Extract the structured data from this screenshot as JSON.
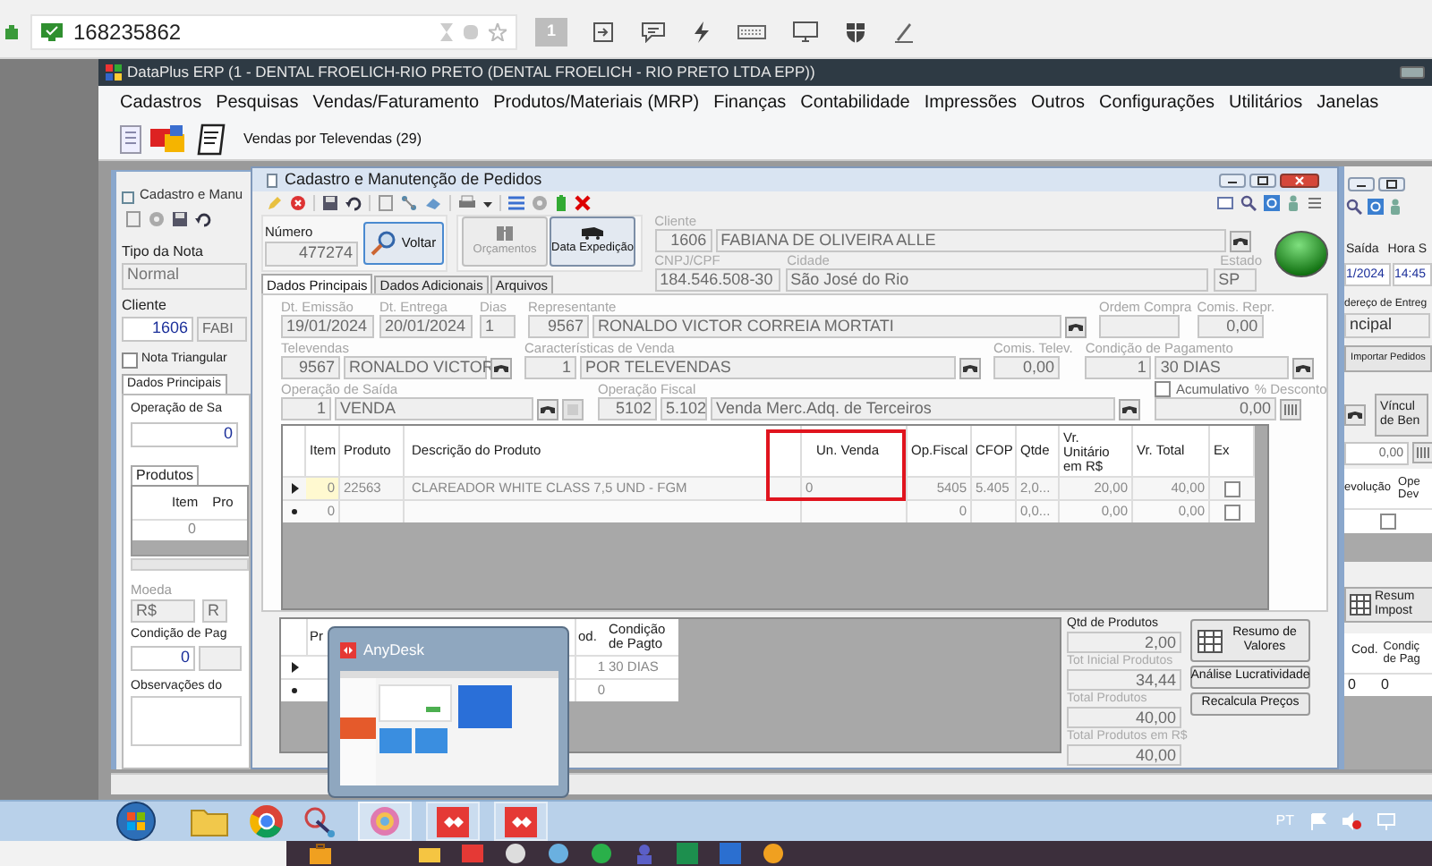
{
  "remote_toolbar": {
    "address": "168235862",
    "display_button": "1"
  },
  "app_window": {
    "title": "DataPlus ERP (1 - DENTAL FROELICH-RIO PRETO  (DENTAL FROELICH - RIO PRETO LTDA EPP))",
    "menu": [
      "Cadastros",
      "Pesquisas",
      "Vendas/Faturamento",
      "Produtos/Materiais (MRP)",
      "Finanças",
      "Contabilidade",
      "Impressões",
      "Outros",
      "Configurações",
      "Utilitários",
      "Janelas"
    ],
    "toolbar_caption": "Vendas por Televendas (29)"
  },
  "left_window": {
    "title": "Cadastro e Manu",
    "tipo_label": "Tipo da Nota",
    "tipo_value": "Normal",
    "cliente_label": "Cliente",
    "cliente_code": "1606",
    "cliente_name": "FABI",
    "nota_triangular": {
      "label": "Nota Triangular",
      "checked": false
    },
    "tab": "Dados Principais",
    "operacao_label": "Operação de Sa",
    "operacao_value": "0",
    "products_tab": "Produtos",
    "grid_columns": [
      "Item",
      "Pro"
    ],
    "grid_row": "0",
    "moeda_label": "Moeda",
    "moeda_values": [
      "R$",
      "R"
    ],
    "condicao_label": "Condição de Pag",
    "condicao_value": "0",
    "observacoes_label": "Observações do"
  },
  "order_window": {
    "title": "Cadastro e Manutenção de Pedidos",
    "numero": {
      "label": "Número",
      "value": "477274"
    },
    "buttons": [
      {
        "label": "Voltar",
        "disabled": false
      },
      {
        "label": "Orçamentos",
        "disabled": true
      },
      {
        "label": "Data Expedição",
        "disabled": false
      }
    ],
    "cliente": {
      "label": "Cliente",
      "code": "1606",
      "name": "FABIANA DE OLIVEIRA ALLE",
      "cnpj_label": "CNPJ/CPF",
      "cnpj": "184.546.508-30",
      "cidade_label": "Cidade",
      "cidade": "São José do Rio",
      "estado_label": "Estado",
      "estado": "SP"
    },
    "tabs": [
      {
        "label": "Dados Principais",
        "selected": true
      },
      {
        "label": "Dados Adicionais",
        "selected": false
      },
      {
        "label": "Arquivos",
        "selected": false
      }
    ],
    "form_rows": [
      [
        {
          "label": "Dt. Emissão",
          "values": [
            "19/01/2024"
          ]
        },
        {
          "label": "Dt. Entrega",
          "values": [
            "20/01/2024"
          ]
        },
        {
          "label": "Dias",
          "values": [
            "1"
          ]
        },
        {
          "label": "Representante",
          "values": [
            "9567",
            "RONALDO VICTOR CORREIA MORTATI"
          ],
          "lookup": true
        },
        {
          "label": "Ordem Compra"
        },
        {
          "label": "Comis. Repr.",
          "values": [
            "0,00"
          ]
        }
      ],
      [
        {
          "label": "Televendas",
          "values": [
            "9567",
            "RONALDO VICTOR"
          ],
          "lookup": true
        },
        {
          "label": "Características de Venda",
          "values": [
            "1",
            "POR TELEVENDAS"
          ],
          "lookup": true
        },
        {
          "label": "Comis. Telev.",
          "values": [
            "0,00"
          ]
        },
        {
          "label": "Condição de Pagamento",
          "values": [
            "1",
            "30 DIAS"
          ],
          "lookup": true
        }
      ],
      [
        {
          "label": "Operação de Saída",
          "values": [
            "1",
            "VENDA"
          ],
          "lookup": true
        },
        {
          "label": "Operação Fiscal",
          "values": [
            "5102",
            "5.102",
            "Venda Merc.Adq. de Terceiros"
          ],
          "lookup": true
        },
        {
          "label": "% Desconto",
          "values": [
            "0,00"
          ],
          "checkbox": {
            "label": "Acumulativo",
            "checked": false
          }
        }
      ]
    ],
    "grid": {
      "columns": [
        {
          "label": "Item",
          "highlighted": false
        },
        {
          "label": "Produto",
          "highlighted": false
        },
        {
          "label": "Descrição do Produto",
          "highlighted": false
        },
        {
          "label": "Un. Venda",
          "highlighted": true
        },
        {
          "label": "Op.Fiscal",
          "highlighted": false
        },
        {
          "label": "CFOP",
          "highlighted": false
        },
        {
          "label": "Qtde",
          "highlighted": false
        },
        {
          "label": "Vr. Unitário em R$",
          "highlighted": false
        },
        {
          "label": "Vr. Total",
          "highlighted": false
        },
        {
          "label": "Ex",
          "highlighted": false
        }
      ],
      "rows": [
        {
          "kind": "current",
          "cells": [
            "0",
            "22563",
            "CLAREADOR WHITE CLASS 7,5 UND - FGM",
            "0",
            "5405",
            "5.405",
            "2,0...",
            "20,00",
            "40,00"
          ],
          "ex": false
        },
        {
          "kind": "new",
          "cells": [
            "0",
            "",
            "",
            "",
            "0",
            "",
            "0,0...",
            "0,00",
            "0,00"
          ],
          "ex": false
        }
      ]
    },
    "bottom_grid": {
      "columns": [
        "Pr",
        "od.",
        "Condição de Pagto"
      ],
      "rows": [
        {
          "kind": "current",
          "cells": [
            "",
            "1",
            "30 DIAS"
          ]
        },
        {
          "kind": "new",
          "cells": [
            "",
            "0",
            ""
          ]
        }
      ]
    },
    "totals": [
      {
        "label": "Qtd de Produtos",
        "value": "2,00"
      },
      {
        "label": "Tot Inicial Produtos",
        "value": "34,44"
      },
      {
        "label": "Total Produtos",
        "value": "40,00"
      },
      {
        "label": "Total Produtos em R$",
        "value": "40,00"
      }
    ],
    "action_buttons": [
      "Resumo de Valores",
      "Análise Lucratividade",
      "Recalcula Preços"
    ]
  },
  "right_window": {
    "saida_label": "Saída",
    "hora_label": "Hora S",
    "saida": "1/2024",
    "hora": "14:45",
    "endereco_label": "dereço de Entreg",
    "endereco": "ncipal",
    "import_button": "Importar Pedidos",
    "vinculo_button": [
      "Víncul",
      "de Ben"
    ],
    "value": "0,00",
    "grid_columns": [
      "evolução",
      "Ope Dev"
    ],
    "grid_row_checked": false,
    "summary_button": [
      "Resum",
      "Impost"
    ],
    "bottom_columns": [
      "Cod.",
      "Condiç de Pag"
    ],
    "bottom_row": [
      "0",
      "0"
    ]
  },
  "anydesk_preview": {
    "title": "AnyDesk"
  },
  "taskbar": {
    "language": "PT"
  }
}
